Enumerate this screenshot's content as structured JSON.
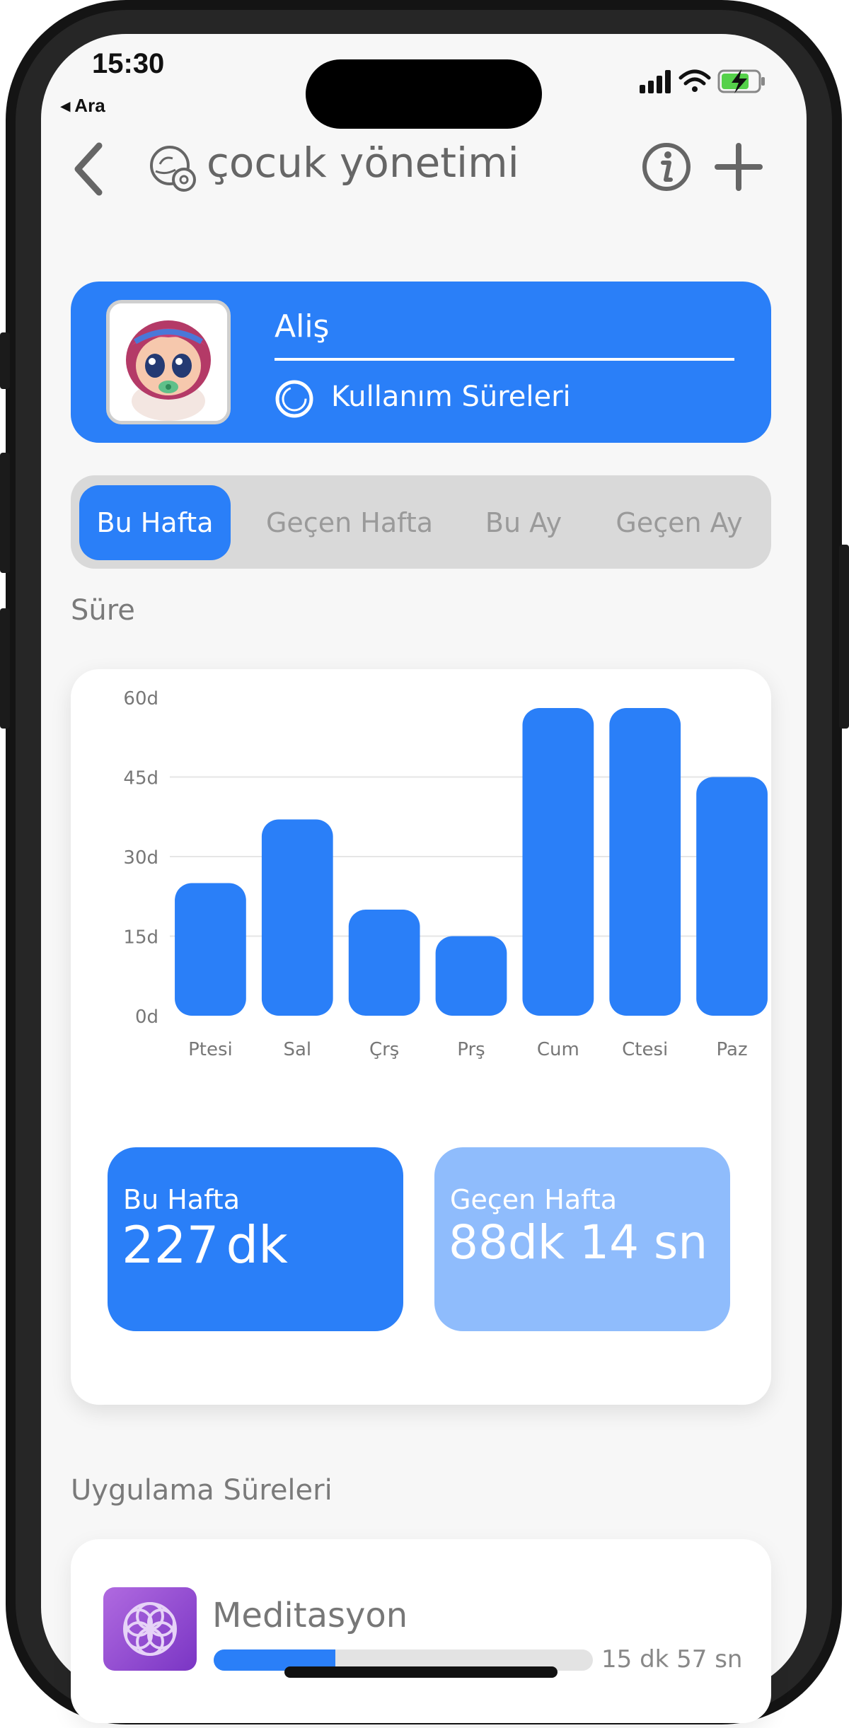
{
  "status_bar": {
    "time": "15:30",
    "back_label": "◂ Ara"
  },
  "nav": {
    "title": "çocuk yönetimi"
  },
  "profile": {
    "name": "Aliş",
    "usage_label": "Kullanım Süreleri"
  },
  "tabs": [
    {
      "label": "Bu Hafta",
      "active": true
    },
    {
      "label": "Geçen Hafta",
      "active": false
    },
    {
      "label": "Bu Ay",
      "active": false
    },
    {
      "label": "Geçen Ay",
      "active": false
    }
  ],
  "duration_section": {
    "label": "Süre"
  },
  "chart_data": {
    "type": "bar",
    "categories": [
      "Ptesi",
      "Sal",
      "Çrş",
      "Prş",
      "Cum",
      "Ctesi",
      "Paz"
    ],
    "values": [
      25,
      37,
      20,
      15,
      58,
      58,
      45
    ],
    "y_ticks": [
      "0d",
      "15d",
      "30d",
      "45d",
      "60d"
    ],
    "ylim": [
      0,
      60
    ],
    "grid": true,
    "bar_color": "#2a7ff8"
  },
  "stats": {
    "this_week": {
      "title": "Bu Hafta",
      "value": "227",
      "unit": "dk"
    },
    "last_week": {
      "title": "Geçen Hafta",
      "value": "88dk 14 sn"
    }
  },
  "apps_section": {
    "label": "Uygulama Süreleri"
  },
  "apps": [
    {
      "name": "Meditasyon",
      "time": "15 dk 57 sn",
      "progress": 0.32
    }
  ],
  "colors": {
    "accent": "#2a7ff8",
    "accent_light": "#8fbcfc",
    "tab_track": "#d9d9d9"
  }
}
